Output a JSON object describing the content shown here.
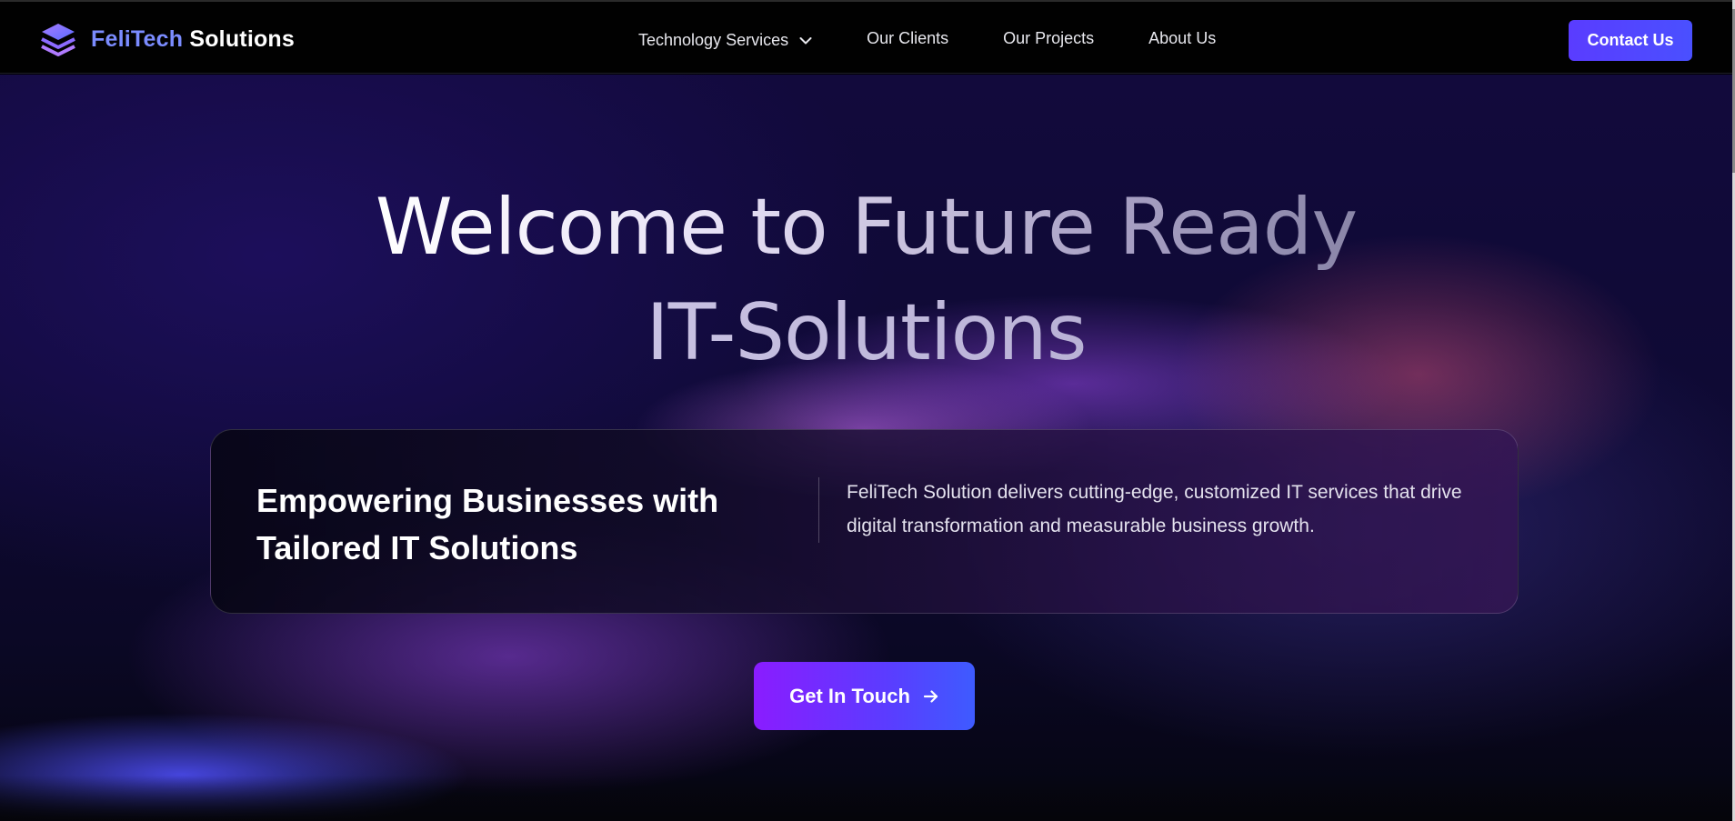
{
  "brand": {
    "name_part1": "FeliTech",
    "name_part2": "Solutions",
    "logo_icon": "layers-stack-icon"
  },
  "nav": {
    "items": [
      {
        "label": "Technology Services",
        "has_dropdown": true
      },
      {
        "label": "Our Clients"
      },
      {
        "label": "Our Projects"
      },
      {
        "label": "About Us"
      }
    ],
    "contact_label": "Contact Us"
  },
  "hero": {
    "headline_line1": "Welcome to Future Ready",
    "headline_line2": "IT-Solutions",
    "card_title": "Empowering Businesses with Tailored IT Solutions",
    "card_description": "FeliTech Solution delivers cutting-edge, customized IT services that drive digital transformation and measurable business growth.",
    "cta_label": "Get In Touch",
    "cta_icon": "arrow-right-icon"
  },
  "colors": {
    "brand_accent": "#7b8cff",
    "contact_button": "#5a3cff",
    "cta_gradient_start": "#8a1cff",
    "cta_gradient_end": "#3e5bff",
    "hero_background": "#0f0a35"
  }
}
